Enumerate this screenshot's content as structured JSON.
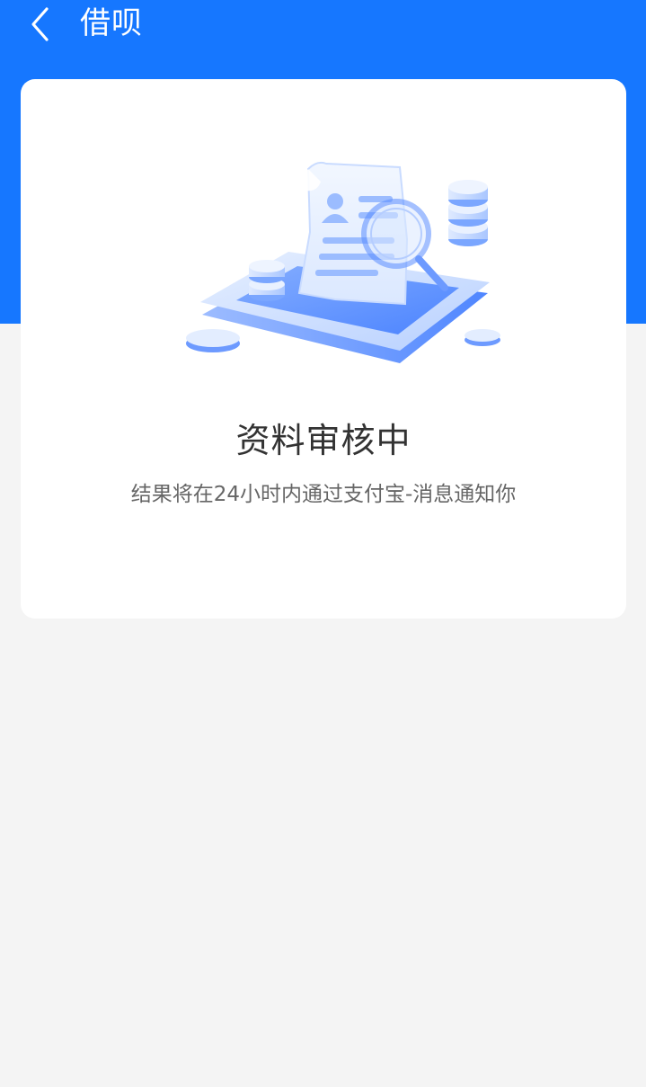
{
  "nav": {
    "title": "借呗",
    "back_icon": "chevron-left-icon"
  },
  "status": {
    "title": "资料审核中",
    "description": "结果将在24小时内通过支付宝-消息通知你"
  },
  "colors": {
    "primary": "#1677ff",
    "background": "#f4f4f4",
    "card": "#ffffff",
    "title_text": "#333333",
    "desc_text": "#666666"
  },
  "illustration": {
    "icon": "document-review-magnifier-icon"
  }
}
